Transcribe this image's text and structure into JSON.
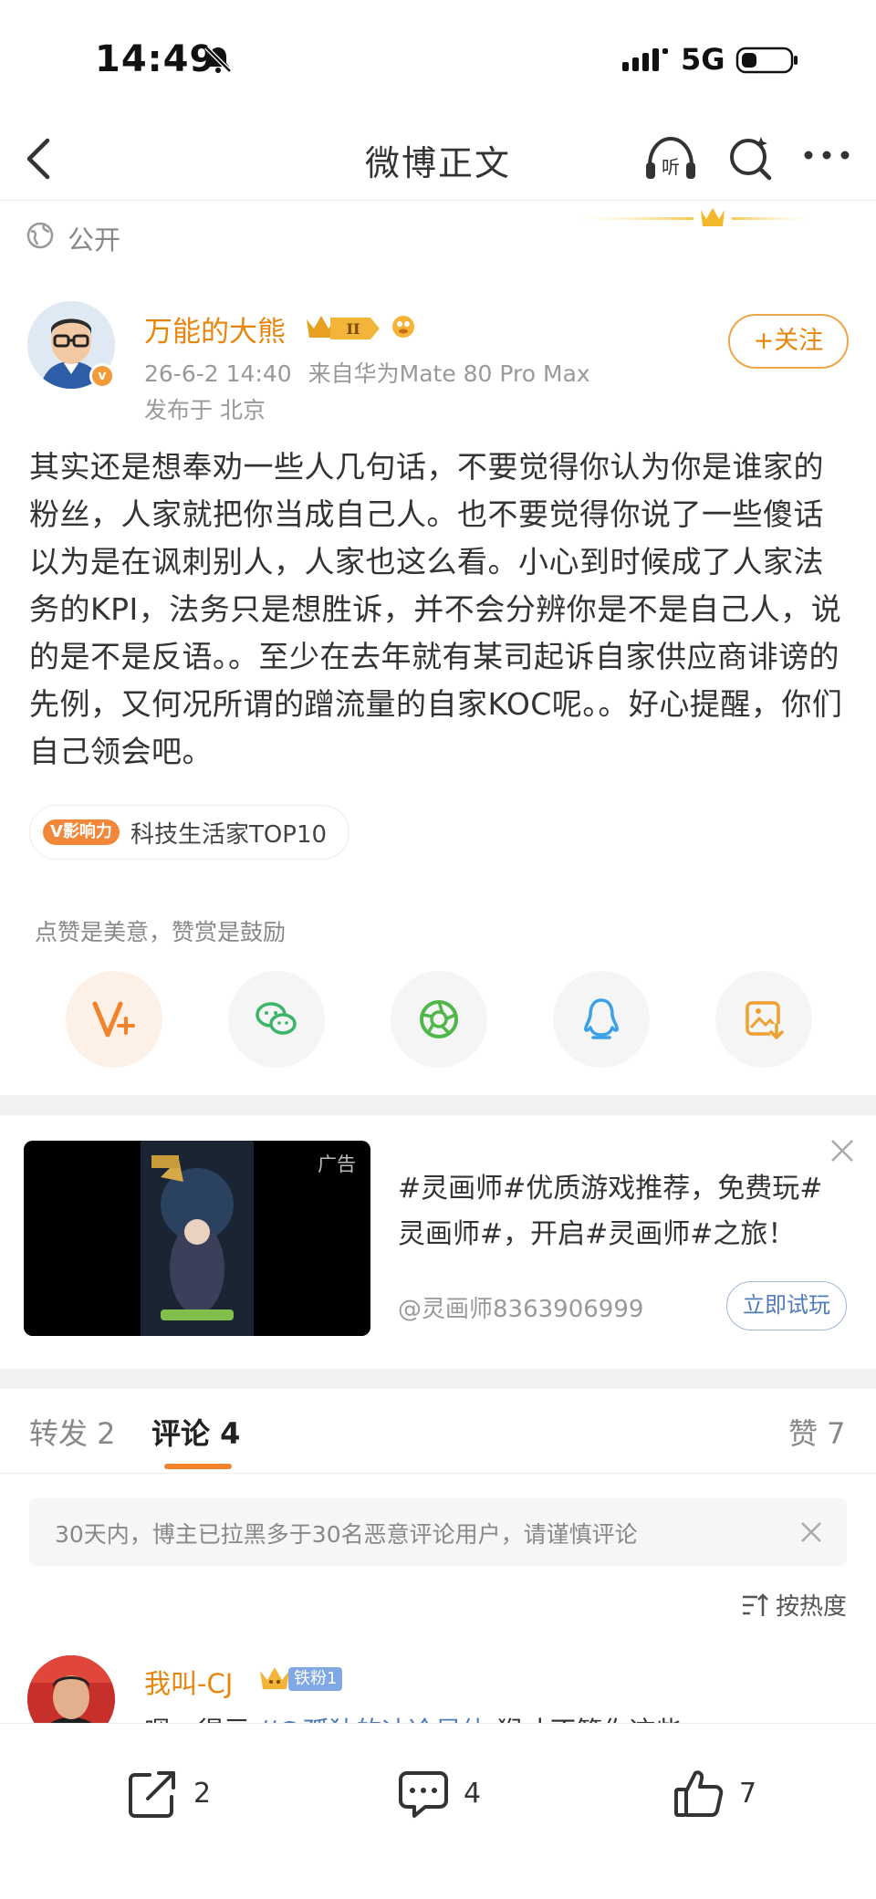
{
  "status_bar": {
    "time": "14:49",
    "network": "5G"
  },
  "nav": {
    "title": "微博正文"
  },
  "visibility": {
    "label": "公开"
  },
  "author": {
    "name": "万能的大熊",
    "date_time": "26-6-2 14:40",
    "source": "来自华为Mate 80 Pro Max",
    "location": "发布于 北京",
    "follow_label": "+关注"
  },
  "post": {
    "text": "其实还是想奉劝一些人几句话，不要觉得你认为你是谁家的粉丝，人家就把你当成自己人。也不要觉得你说了一些傻话以为是在讽刺别人，人家也这么看。小心到时候成了人家法务的KPI，法务只是想胜诉，并不会分辨你是不是自己人，说的是不是反语。。至少在去年就有某司起诉自家供应商诽谤的先例，又何况所谓的蹭流量的自家KOC呢。。好心提醒，你们自己领会吧。"
  },
  "influence": {
    "tag": "V影响力",
    "text": "科技生活家TOP10"
  },
  "praise_hint": "点赞是美意，赞赏是鼓励",
  "share_icons": [
    "praise-v-icon",
    "wechat-icon",
    "moments-icon",
    "qq-icon",
    "save-image-icon"
  ],
  "ad": {
    "label": "广告",
    "text": "#灵画师#优质游戏推荐，免费玩#灵画师#，开启#灵画师#之旅！",
    "author": "@灵画师8363906999",
    "button": "立即试玩"
  },
  "tabs": {
    "repost": "转发 2",
    "comments": "评论 4",
    "likes": "赞 7"
  },
  "notice": {
    "text": "30天内，博主已拉黑多于30名恶意评论用户，请谨慎评论"
  },
  "sort": {
    "label": "按热度"
  },
  "comment": {
    "name": "我叫-CJ",
    "fan_badge": "铁粉1",
    "text_start": "嗯，得亏 ",
    "mention": "//@孤独的冰冷星体",
    "text_rest": ":猴才不管你这些"
  },
  "bottom_bar": {
    "reposts": "2",
    "comments": "4",
    "likes": "7"
  },
  "colors": {
    "accent_orange": "#e8850c",
    "link_blue": "#4f7bb8"
  }
}
